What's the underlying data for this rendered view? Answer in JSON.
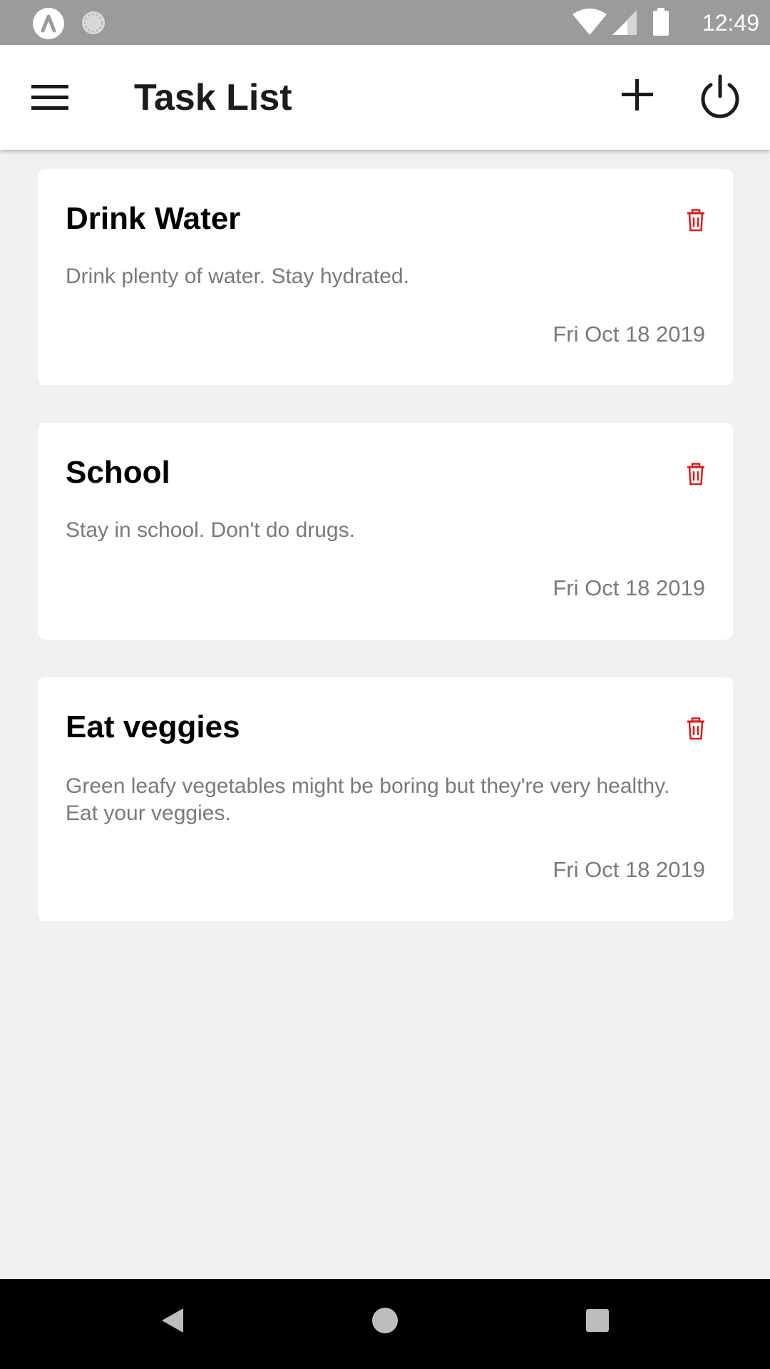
{
  "status_bar": {
    "time": "12:49",
    "icons": [
      "app-icon",
      "sync-icon",
      "wifi-icon",
      "signal-icon",
      "battery-icon"
    ]
  },
  "app_bar": {
    "title": "Task List",
    "icons": [
      "menu-icon",
      "plus-icon",
      "power-icon"
    ]
  },
  "tasks": [
    {
      "title": "Drink Water",
      "description": "Drink plenty of water. Stay hydrated.",
      "date": "Fri Oct 18 2019"
    },
    {
      "title": "School",
      "description": "Stay in school. Don't do drugs.",
      "date": "Fri Oct 18 2019"
    },
    {
      "title": "Eat veggies",
      "description": "Green leafy vegetables might be boring but they're very healthy. Eat your veggies.",
      "date": "Fri Oct 18 2019"
    }
  ],
  "nav_bar": {
    "icons": [
      "back-icon",
      "home-icon",
      "recents-icon"
    ]
  },
  "colors": {
    "status_bar": "#9b9b9b",
    "app_bar": "#ffffff",
    "background": "#f1f1f1",
    "card": "#ffffff",
    "title_text": "#000000",
    "secondary_text": "#7a7a7a",
    "delete_icon": "#e01b1b",
    "nav_bar": "#000000"
  }
}
